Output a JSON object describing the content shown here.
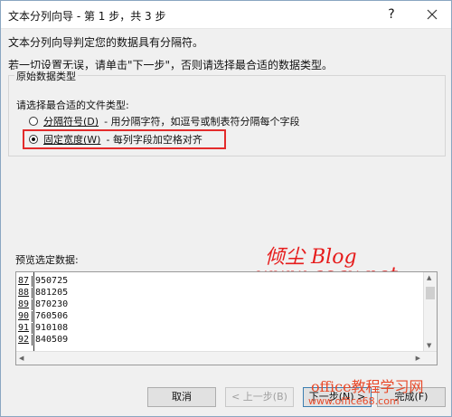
{
  "window": {
    "title": "文本分列向导 - 第 1 步，共 3 步",
    "help_label": "?"
  },
  "intro": {
    "line1": "文本分列向导判定您的数据具有分隔符。",
    "line2": "若一切设置无误，请单击\"下一步\"，否则请选择最合适的数据类型。"
  },
  "group": {
    "title": "原始数据类型",
    "prompt": "请选择最合适的文件类型:",
    "options": [
      {
        "label": "分隔符号(D)",
        "desc": "- 用分隔字符，如逗号或制表符分隔每个字段",
        "checked": false
      },
      {
        "label": "固定宽度(W)",
        "desc": "- 每列字段加空格对齐",
        "checked": true
      }
    ]
  },
  "preview": {
    "label": "预览选定数据:",
    "rows": [
      {
        "num": "87",
        "value": "950725"
      },
      {
        "num": "88",
        "value": "881205"
      },
      {
        "num": "89",
        "value": "870230"
      },
      {
        "num": "90",
        "value": "760506"
      },
      {
        "num": "91",
        "value": "910108"
      },
      {
        "num": "92",
        "value": "840509"
      }
    ]
  },
  "buttons": {
    "cancel": "取消",
    "back": "< 上一步(B)",
    "next": "下一步(N) >",
    "finish": "完成(F)"
  },
  "watermarks": {
    "brand_cn": "倾尘",
    "brand_en": "Blog",
    "url": "www.qcqx.net",
    "site": "office教程学习网",
    "site_url": "www.office68.com"
  },
  "colors": {
    "highlight_box": "#e32b2b",
    "watermark": "#e61c1c"
  }
}
